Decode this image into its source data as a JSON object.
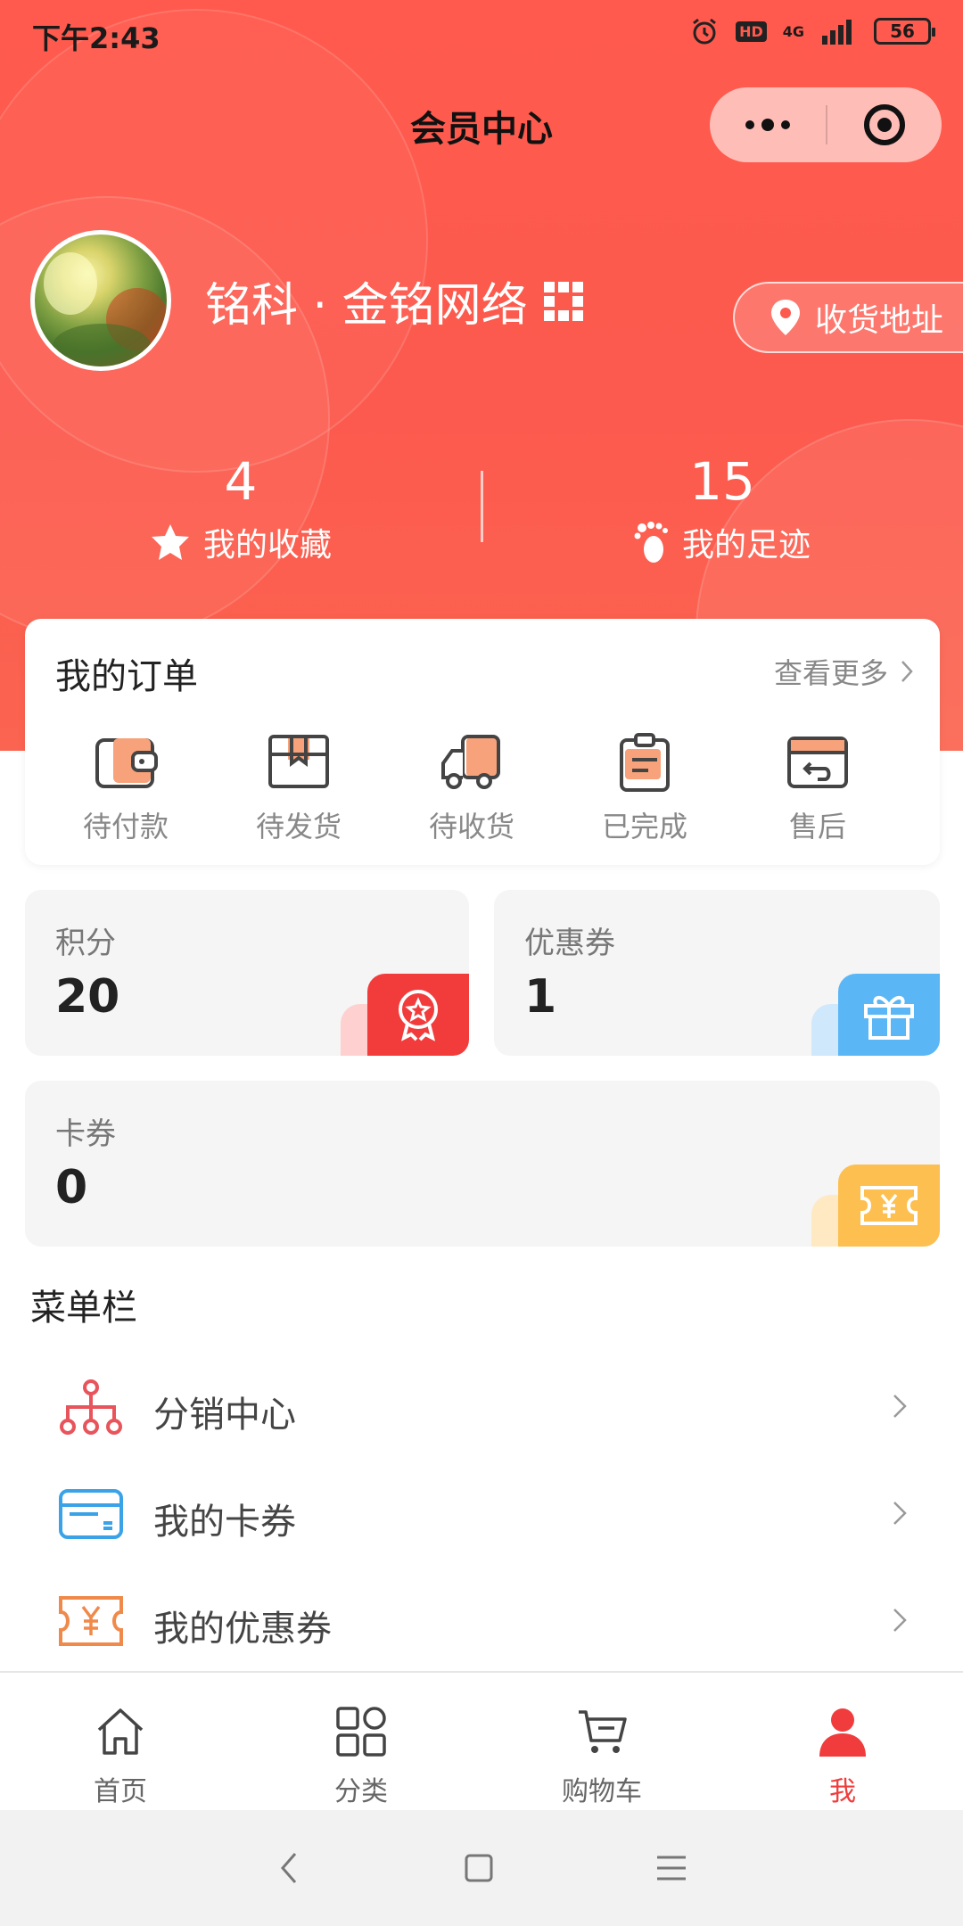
{
  "status_bar": {
    "time": "下午2:43",
    "hd": "HD",
    "network": "4G",
    "battery": "56"
  },
  "navbar": {
    "title": "会员中心"
  },
  "profile": {
    "name": "铭科 · 金铭网络",
    "address_button": "收货地址"
  },
  "stats": [
    {
      "value": "4",
      "label": "我的收藏",
      "icon": "star-icon"
    },
    {
      "value": "15",
      "label": "我的足迹",
      "icon": "footprint-icon"
    }
  ],
  "orders": {
    "title": "我的订单",
    "more": "查看更多",
    "items": [
      {
        "label": "待付款",
        "icon": "wallet-icon"
      },
      {
        "label": "待发货",
        "icon": "package-icon"
      },
      {
        "label": "待收货",
        "icon": "truck-icon"
      },
      {
        "label": "已完成",
        "icon": "clipboard-icon"
      },
      {
        "label": "售后",
        "icon": "return-card-icon"
      }
    ]
  },
  "assets": {
    "points": {
      "label": "积分",
      "value": "20",
      "icon": "medal-icon",
      "color": "#f23c3c"
    },
    "coupons": {
      "label": "优惠券",
      "value": "1",
      "icon": "gift-icon",
      "color": "#5bb6f5"
    },
    "cards": {
      "label": "卡券",
      "value": "0",
      "icon": "ticket-icon",
      "color": "#fdbf4f"
    }
  },
  "menu": {
    "title": "菜单栏",
    "items": [
      {
        "label": "分销中心",
        "icon": "distribution-icon"
      },
      {
        "label": "我的卡券",
        "icon": "card-icon"
      },
      {
        "label": "我的优惠券",
        "icon": "coupon-icon"
      }
    ]
  },
  "tabbar": {
    "items": [
      {
        "label": "首页",
        "icon": "home-icon"
      },
      {
        "label": "分类",
        "icon": "category-icon"
      },
      {
        "label": "购物车",
        "icon": "cart-icon"
      },
      {
        "label": "我",
        "icon": "user-icon",
        "active": true
      }
    ]
  },
  "colors": {
    "brand": "#fc5a4e",
    "active_tab": "#f03c3c"
  }
}
